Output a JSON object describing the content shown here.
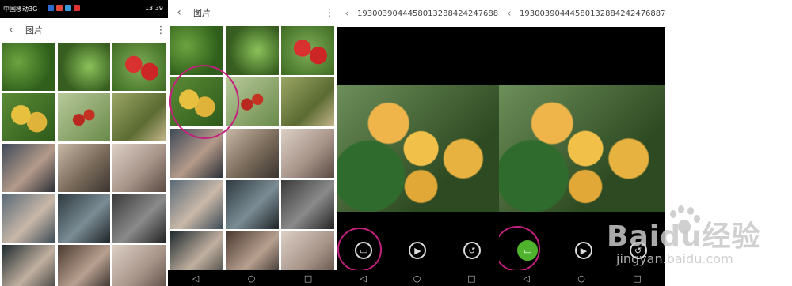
{
  "status_bar": {
    "carrier": "中国移动3G",
    "time": "13:39"
  },
  "gallery1": {
    "title": "图片"
  },
  "gallery2": {
    "title": "图片"
  },
  "viewer1": {
    "filename": "19300390444580132884242476887..."
  },
  "viewer2": {
    "filename": "19300390444580132884242476887..."
  },
  "icons": {
    "back": "chevron-left-icon",
    "more": "more-vert-icon",
    "play": "play-icon",
    "rotate": "rotate-icon",
    "slideshow": "slideshow-icon"
  },
  "colors": {
    "annotation": "#c4207e",
    "active_button": "#4fb32e"
  },
  "watermark": {
    "brand": "Baidu经验",
    "url": "jingyan.baidu.com"
  }
}
